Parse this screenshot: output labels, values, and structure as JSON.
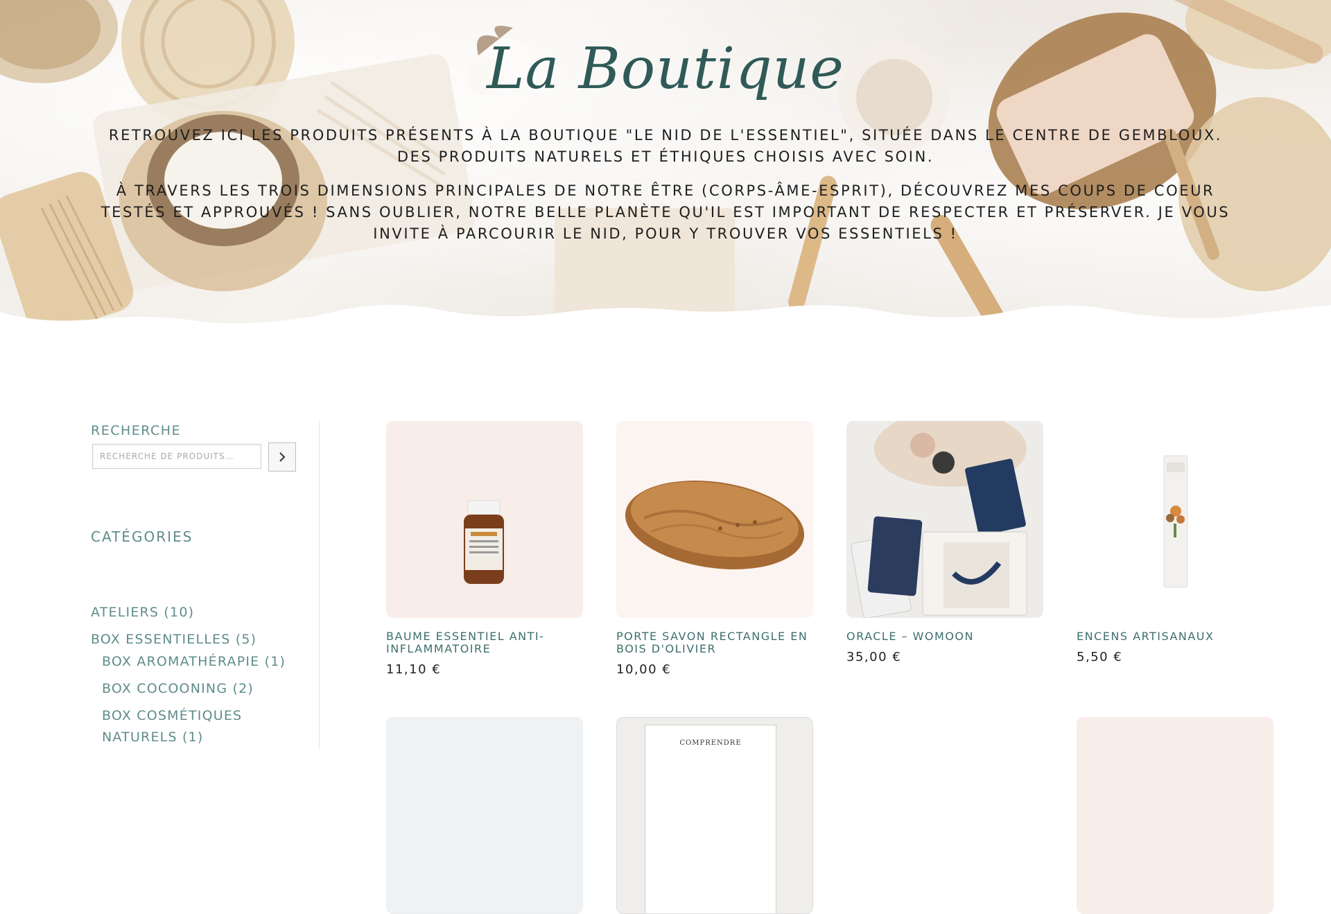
{
  "hero": {
    "title": "La Boutique",
    "paragraph_1": "Retrouvez ici les produits présents à la boutique \"Le Nid de l'Essentiel\", située dans le centre de Gembloux. Des produits naturels et éthiques choisis avec soin.",
    "paragraph_2": "À travers les trois dimensions principales de notre être (Corps-Âme-Esprit), découvrez mes coups de coeur testés et approuvés ! Sans oublier, notre belle planète qu'il est important de respecter et préserver. Je vous invite à parcourir le nid, pour y trouver vos essentiels !"
  },
  "sidebar": {
    "search_title": "Recherche",
    "search_placeholder": "Recherche de produits…",
    "categories_title": "Catégories",
    "categories": [
      {
        "label": "Ateliers (10)"
      },
      {
        "label": "Box Essentielles (5)"
      },
      {
        "label": "Box Aromathérapie (1)"
      },
      {
        "label": "Box Cocooning (2)"
      },
      {
        "label": "Box Cosmétiques Naturels (1)"
      }
    ]
  },
  "products": [
    {
      "name": "Baume essentiel anti-inflammatoire",
      "price": "11,10 €",
      "image": "essential-oil-bottle"
    },
    {
      "name": "Porte savon rectangle en bois d'olivier",
      "price": "10,00 €",
      "image": "olive-wood-soap-dish"
    },
    {
      "name": "Oracle – Womoon",
      "price": "35,00 €",
      "image": "oracle-cards"
    },
    {
      "name": "Encens artisanaux",
      "price": "5,50 €",
      "image": "incense-pack"
    }
  ],
  "next_row_partial": {
    "book_text": "COMPRENDRE"
  },
  "colors": {
    "accent": "#5f8c8a",
    "title": "#2f5a57",
    "product_bg_pink": "#f8ede8"
  }
}
